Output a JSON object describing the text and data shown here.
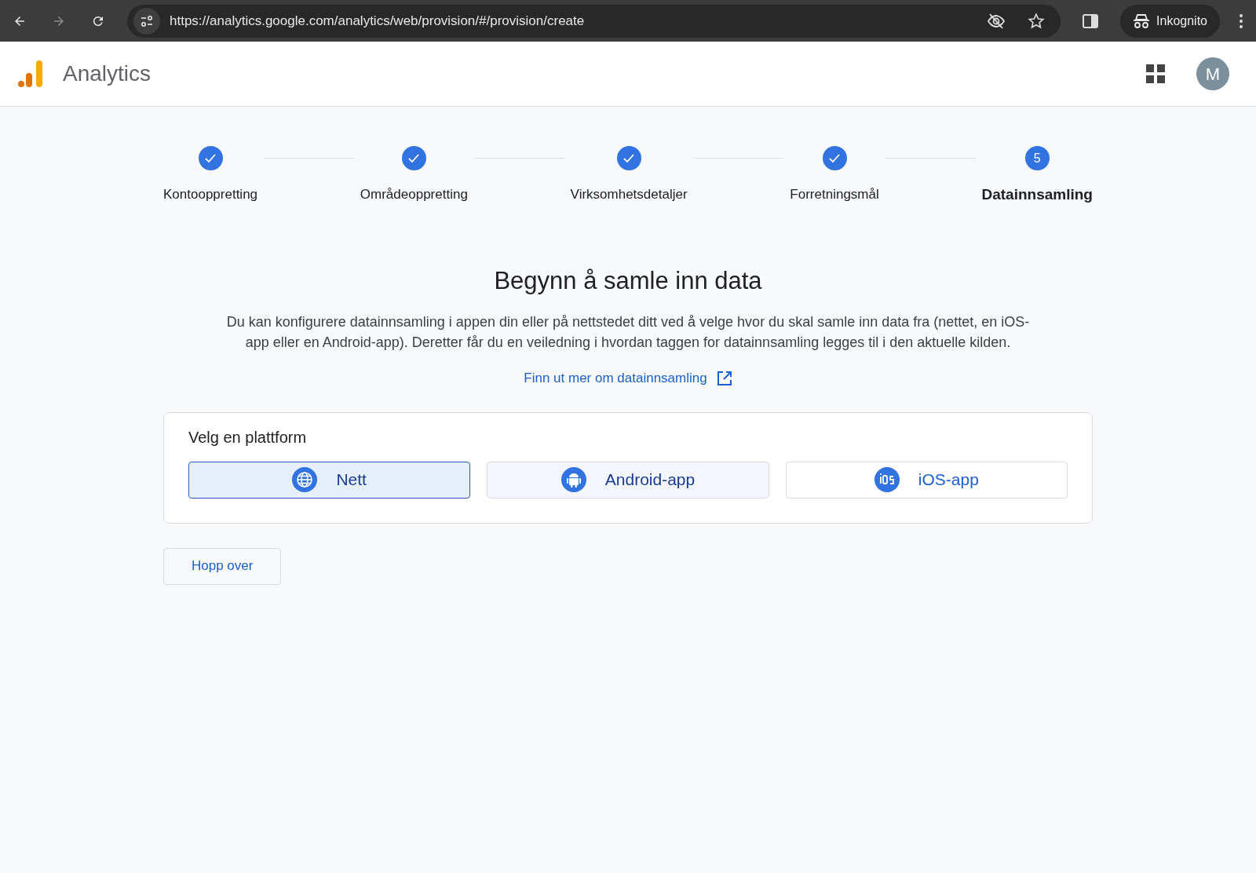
{
  "browser": {
    "url": "https://analytics.google.com/analytics/web/provision/#/provision/create",
    "profile": "Inkognito"
  },
  "app": {
    "name": "Analytics",
    "avatar": "M"
  },
  "steps": [
    {
      "label": "Kontooppretting",
      "done": true,
      "selected": false
    },
    {
      "label": "Områdeoppretting",
      "done": true,
      "selected": false
    },
    {
      "label": "Virksomhetsdetaljer",
      "done": true,
      "selected": false
    },
    {
      "label": "Forretningsmål",
      "done": true,
      "selected": false
    },
    {
      "label": "Datainnsamling",
      "done": false,
      "selected": true,
      "number": "5"
    }
  ],
  "heading": "Begynn å samle inn data",
  "description": "Du kan konfigurere datainnsamling i appen din eller på nettstedet ditt ved å velge hvor du skal samle inn data fra (nettet, en iOS-app eller en Android-app). Deretter får du en veiledning i hvordan taggen for datainnsamling legges til i den aktuelle kilden.",
  "learn_more_link": "Finn ut mer om datainnsamling",
  "platform_card": {
    "title": "Velg en plattform",
    "options": [
      {
        "kind": "web",
        "label": "Nett",
        "selected": true,
        "hovered": false
      },
      {
        "kind": "android",
        "label": "Android-app",
        "selected": false,
        "hovered": true
      },
      {
        "kind": "ios",
        "label": "iOS-app",
        "selected": false,
        "hovered": false
      }
    ]
  },
  "skip_button": "Hopp over"
}
